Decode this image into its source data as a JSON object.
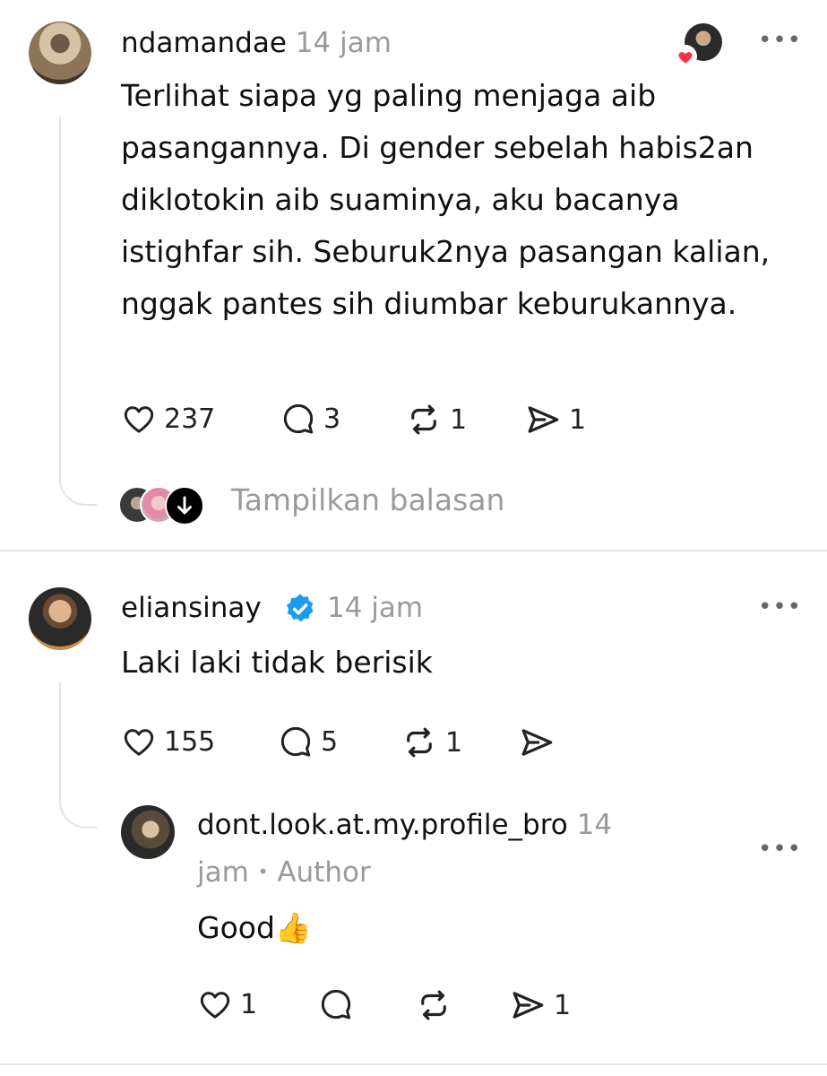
{
  "post1": {
    "username": "ndamandae",
    "time": "14 jam",
    "text": "Terlihat siapa yg paling menjaga aib pasangannya. Di gender sebelah habis2an diklotokin aib suaminya, aku bacanya istighfar sih. Seburuk2nya pasangan kalian, nggak pantes sih diumbar keburukannya.",
    "likes": "237",
    "replies": "3",
    "reposts": "1",
    "shares": "1",
    "show_replies": "Tampilkan balasan"
  },
  "post2": {
    "username": "eliansinay",
    "time": "14 jam",
    "text": "Laki laki tidak berisik",
    "likes": "155",
    "replies": "5",
    "reposts": "1"
  },
  "reply": {
    "username": "dont.look.at.my.profile_bro",
    "time_part1": "14",
    "time_part2": "jam",
    "separator": "•",
    "badge": "Author",
    "text": "Good👍",
    "likes": "1",
    "shares": "1"
  },
  "colors": {
    "verified": "#1d9bf0",
    "heart_badge": "#ff3040",
    "muted": "#9a9a9a"
  }
}
